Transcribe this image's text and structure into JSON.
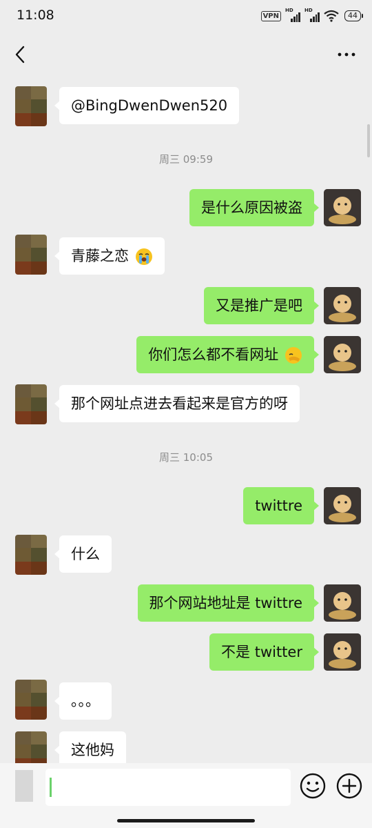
{
  "status_bar": {
    "time": "11:08",
    "vpn": "VPN",
    "hd1": "HD",
    "hd2": "HD",
    "battery": "44"
  },
  "nav": {
    "back_icon": "chevron-left-icon",
    "more_icon": "more-horizontal-icon"
  },
  "chat": {
    "timestamps": [
      "周三 09:59",
      "周三 10:05"
    ],
    "messages": [
      {
        "side": "left",
        "text": "@BingDwenDwen520"
      },
      {
        "side": "right",
        "text": "是什么原因被盗"
      },
      {
        "side": "left",
        "text": "青藤之恋",
        "emoji": "crying-face-icon"
      },
      {
        "side": "right",
        "text": "又是推广是吧"
      },
      {
        "side": "right",
        "text": "你们怎么都不看网址",
        "emoji": "facepalm-icon"
      },
      {
        "side": "left",
        "text": "那个网址点进去看起来是官方的呀"
      },
      {
        "side": "right",
        "text": "twittre"
      },
      {
        "side": "left",
        "text": "什么"
      },
      {
        "side": "right",
        "text": "那个网站地址是 twittre"
      },
      {
        "side": "right",
        "text": "不是 twitter"
      },
      {
        "side": "left",
        "text": "。。。"
      },
      {
        "side": "left",
        "text": "这他妈"
      }
    ]
  },
  "input_bar": {
    "value": "",
    "emoji_icon": "smiley-icon",
    "plus_icon": "plus-circle-icon"
  }
}
